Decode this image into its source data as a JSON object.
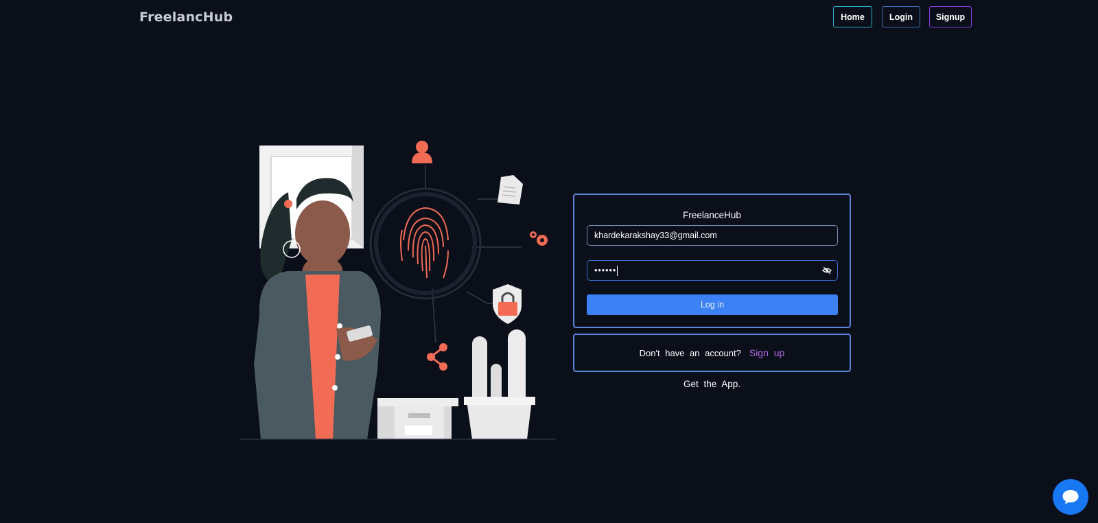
{
  "header": {
    "brand": "FreelancHub",
    "nav": [
      {
        "label": "Home"
      },
      {
        "label": "Login"
      },
      {
        "label": "Signup"
      }
    ]
  },
  "login": {
    "title": "FreelanceHub",
    "email_value": "khardekarakshay33@gmail.com",
    "password_masked": "••••••",
    "submit_label": "Log in"
  },
  "signup": {
    "prompt": "Don't have an account?",
    "link_label": "Sign up"
  },
  "footer": {
    "get_app": "Get the App."
  },
  "icons": {
    "password_toggle": "eye-off-icon",
    "chat": "chat-bubble-icon"
  },
  "colors": {
    "background": "#0b0f1a",
    "accent_blue": "#3c82f6",
    "card_border": "#5a86d8",
    "signup_link": "#b46ae8",
    "illustration_accent": "#f26b55",
    "chat_button": "#1877f2"
  }
}
